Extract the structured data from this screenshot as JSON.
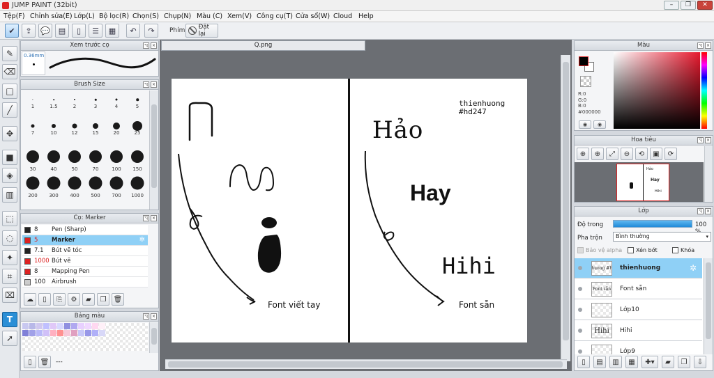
{
  "window": {
    "title": "JUMP PAINT (32bit)"
  },
  "menu": [
    "Tệp(F)",
    "Chỉnh sửa(E)",
    "Lớp(L)",
    "Bộ lọc(R)",
    "Chọn(S)",
    "Chụp(N)",
    "Màu (C)",
    "Xem(V)",
    "Công cụ(T)",
    "Cửa sổ(W)",
    "Cloud",
    "Help"
  ],
  "toolbar": {
    "pen_label": "Phím",
    "reset_label": "Đặt lại"
  },
  "brush_preview": {
    "title": "Xem trước cọ",
    "size": "0.36mm"
  },
  "brush_size": {
    "title": "Brush Size",
    "sizes": [
      "1",
      "1.5",
      "2",
      "3",
      "4",
      "5",
      "7",
      "10",
      "12",
      "15",
      "20",
      "25",
      "30",
      "40",
      "50",
      "70",
      "100",
      "150",
      "200",
      "300",
      "400",
      "500",
      "700",
      "1000"
    ]
  },
  "brush_panel": {
    "title": "Cọ: Marker",
    "items": [
      {
        "size": "8",
        "name": "Pen (Sharp)",
        "color": "#222222"
      },
      {
        "size": "5",
        "name": "Marker",
        "color": "#dd2222",
        "selected": true
      },
      {
        "size": "7.1",
        "name": "Bút vẽ tóc",
        "color": "#222222"
      },
      {
        "size": "1000",
        "name": "Bút vẽ",
        "color": "#dd2222"
      },
      {
        "size": "8",
        "name": "Mapping Pen",
        "color": "#dd2222"
      },
      {
        "size": "100",
        "name": "Airbrush",
        "color": "#cccccc"
      }
    ]
  },
  "palette": {
    "title": "Bảng màu",
    "dash": "---"
  },
  "document": {
    "tab": "Q.png"
  },
  "artwork": {
    "left_caption": "Font viết tay",
    "signature_line1": "thienhuong",
    "signature_line2": "#hd247",
    "word1": "Hảo",
    "word2": "Hay",
    "word3": "Hihi",
    "right_caption": "Font sẵn"
  },
  "color_panel": {
    "title": "Màu",
    "r": "R:0",
    "g": "G:0",
    "b": "B:0",
    "hex": "#000000"
  },
  "navigator": {
    "title": "Hoa tiêu"
  },
  "layers": {
    "title": "Lớp",
    "opacity_label": "Độ trong",
    "opacity_value": "100 %",
    "opacity": 1.0,
    "blend_label": "Pha trộn",
    "blend_value": "Bình thường",
    "protect_alpha": "Bảo vệ alpha",
    "clip": "Xén bớt",
    "lock": "Khóa",
    "items": [
      {
        "name": "thienhuong",
        "thumb": "thienhuong #hd247",
        "selected": true
      },
      {
        "name": "Font sẵn",
        "thumb": "Font sẵn"
      },
      {
        "name": "Lớp10",
        "thumb": ""
      },
      {
        "name": "Hihi",
        "thumb": "Hihi"
      },
      {
        "name": "Lớp9",
        "thumb": ""
      }
    ]
  },
  "colors": {
    "accent": "#2b8fd6",
    "selected_row": "#8fd0f6",
    "canvas_bg": "#6b6e73"
  }
}
